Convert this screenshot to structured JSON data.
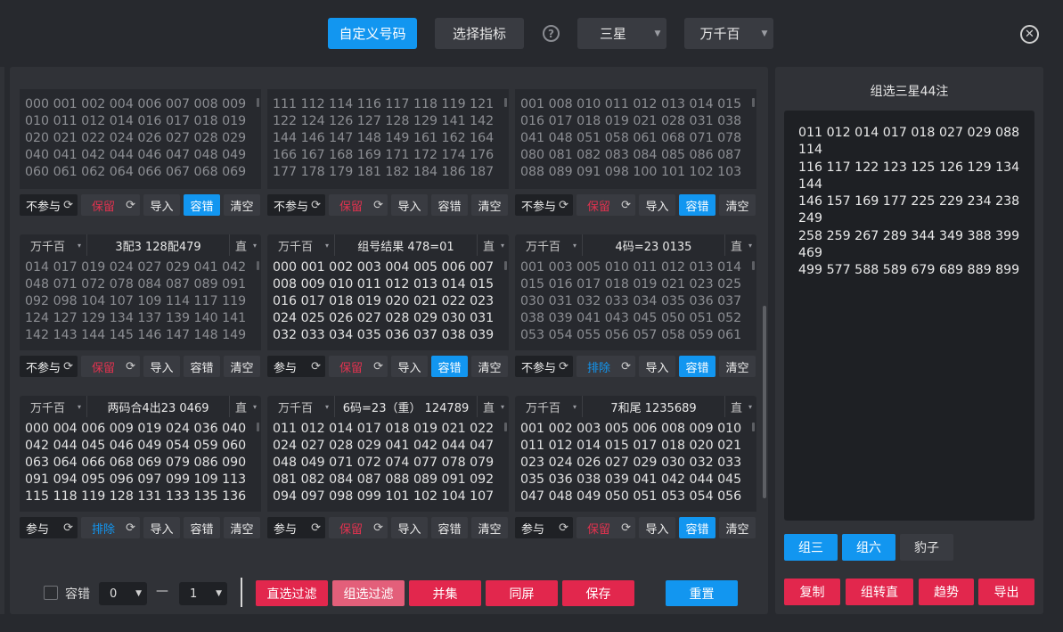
{
  "toolbar": {
    "custom_label": "自定义号码",
    "indicator_label": "选择指标",
    "help_glyph": "?",
    "star_select": "三星",
    "pos_select": "万千百",
    "close_glyph": "✕"
  },
  "cards": [
    {
      "head": null,
      "dim": true,
      "text": "000 001 002 004 006 007 008 009\n010 011 012 014 016 017 018 019\n020 021 022 024 026 027 028 029\n040 041 042 044 046 047 048 049\n060 061 062 064 066 067 068 069",
      "join": "不参与",
      "mode": "保留",
      "mode_type": "keep",
      "tol_on": true
    },
    {
      "head": null,
      "dim": true,
      "text": "111 112 114 116 117 118 119 121\n122 124 126 127 128 129 141 142\n144 146 147 148 149 161 162 164\n166 167 168 169 171 172 174 176\n177 178 179 181 182 184 186 187",
      "join": "不参与",
      "mode": "保留",
      "mode_type": "keep",
      "tol_on": false
    },
    {
      "head": null,
      "dim": true,
      "text": "001 008 010 011 012 013 014 015\n016 017 018 019 021 028 031 038\n041 048 051 058 061 068 071 078\n080 081 082 083 084 085 086 087\n088 089 091 098 100 101 102 103",
      "join": "不参与",
      "mode": "保留",
      "mode_type": "keep",
      "tol_on": true
    },
    {
      "head": {
        "pos": "万千百",
        "title": "3配3 128配479",
        "dir": "直"
      },
      "dim": true,
      "text": "014 017 019 024 027 029 041 042\n048 071 072 078 084 087 089 091\n092 098 104 107 109 114 117 119\n124 127 129 134 137 139 140 141\n142 143 144 145 146 147 148 149",
      "join": "不参与",
      "mode": "保留",
      "mode_type": "keep",
      "tol_on": false
    },
    {
      "head": {
        "pos": "万千百",
        "title": "组号结果 478=01",
        "dir": "直"
      },
      "dim": false,
      "text": "000 001 002 003 004 005 006 007\n008 009 010 011 012 013 014 015\n016 017 018 019 020 021 022 023\n024 025 026 027 028 029 030 031\n032 033 034 035 036 037 038 039",
      "join": "参与",
      "mode": "保留",
      "mode_type": "keep",
      "tol_on": true
    },
    {
      "head": {
        "pos": "万千百",
        "title": "4码=23 0135",
        "dir": "直"
      },
      "dim": true,
      "text": "001 003 005 010 011 012 013 014\n015 016 017 018 019 021 023 025\n030 031 032 033 034 035 036 037\n038 039 041 043 045 050 051 052\n053 054 055 056 057 058 059 061",
      "join": "不参与",
      "mode": "排除",
      "mode_type": "excl",
      "tol_on": true
    },
    {
      "head": {
        "pos": "万千百",
        "title": "两码合4出23 0469",
        "dir": "直"
      },
      "dim": false,
      "text": "000 004 006 009 019 024 036 040\n042 044 045 046 049 054 059 060\n063 064 066 068 069 079 086 090\n091 094 095 096 097 099 109 113\n115 118 119 128 131 133 135 136",
      "join": "参与",
      "mode": "排除",
      "mode_type": "excl",
      "tol_on": false
    },
    {
      "head": {
        "pos": "万千百",
        "title": "6码=23（重） 124789",
        "dir": "直"
      },
      "dim": false,
      "text": "011 012 014 017 018 019 021 022\n024 027 028 029 041 042 044 047\n048 049 071 072 074 077 078 079\n081 082 084 087 088 089 091 092\n094 097 098 099 101 102 104 107",
      "join": "参与",
      "mode": "保留",
      "mode_type": "keep",
      "tol_on": false
    },
    {
      "head": {
        "pos": "万千百",
        "title": "7和尾 1235689",
        "dir": "直"
      },
      "dim": false,
      "text": "001 002 003 005 006 008 009 010\n011 012 014 015 017 018 020 021\n023 024 026 027 029 030 032 033\n035 036 038 039 041 042 044 045\n047 048 049 050 051 053 054 056",
      "join": "参与",
      "mode": "保留",
      "mode_type": "keep",
      "tol_on": true
    }
  ],
  "card_actions": {
    "import": "导入",
    "tolerance": "容错",
    "clear": "清空",
    "refresh_glyph": "⟳",
    "caret": "▾"
  },
  "filter_bar": {
    "tolerance_label": "容错",
    "min_value": "0",
    "dash": "—",
    "max_value": "1",
    "direct_filter": "直选过滤",
    "group_filter": "组选过滤",
    "union": "并集",
    "same_screen": "同屏",
    "save": "保存",
    "reset": "重置"
  },
  "result_panel": {
    "title": "组选三星44注",
    "numbers": "011 012 014 017 018 027 029 088 114\n116 117 122 123 125 126 129 134 144\n146 157 169 177 225 229 234 238 249\n258 259 267 289 344 349 388 399 469\n499 577 588 589 679 689 889 899",
    "group3": "组三",
    "group6": "组六",
    "leopard": "豹子",
    "copy": "复制",
    "to_direct": "组转直",
    "trend": "趋势",
    "export": "导出"
  },
  "colors": {
    "accent_blue": "#1296f0",
    "accent_red": "#e2274d",
    "panel": "#303237",
    "bg": "#27292e"
  }
}
